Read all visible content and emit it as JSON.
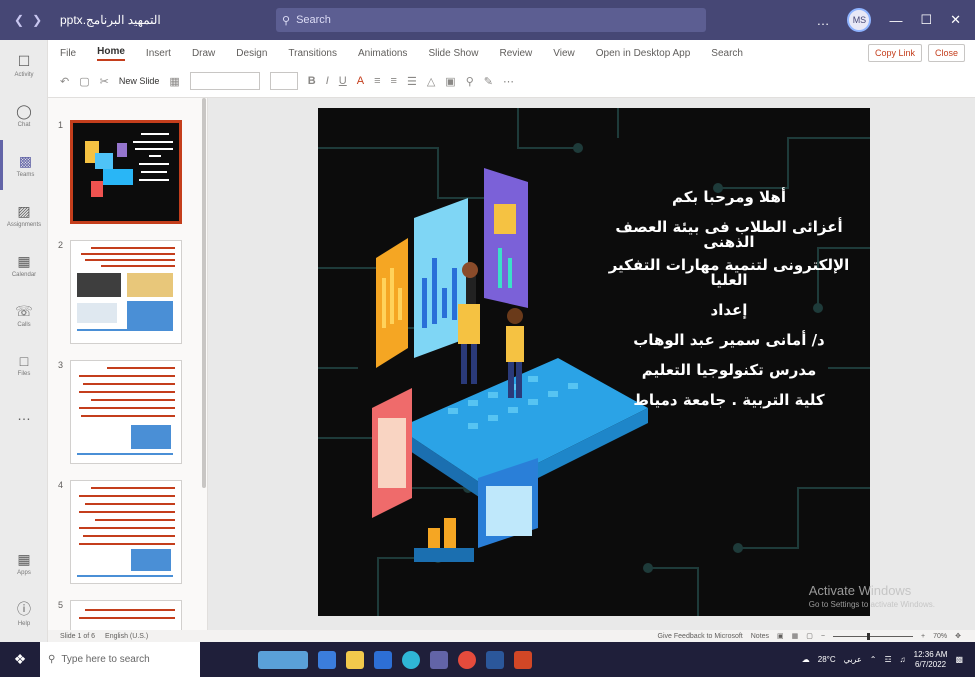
{
  "window": {
    "title": "التمهيد البرنامج.pptx",
    "search_placeholder": "Search",
    "avatar_initials": "MS",
    "controls": [
      "…",
      "—",
      "☐",
      "✕"
    ]
  },
  "rail": {
    "items": [
      {
        "label": "Activity",
        "icon": "bell-icon"
      },
      {
        "label": "Chat",
        "icon": "chat-icon"
      },
      {
        "label": "Teams",
        "icon": "teams-icon"
      },
      {
        "label": "Assignments",
        "icon": "assignments-icon"
      },
      {
        "label": "Calendar",
        "icon": "calendar-icon"
      },
      {
        "label": "Calls",
        "icon": "phone-icon"
      },
      {
        "label": "Files",
        "icon": "file-icon"
      },
      {
        "label": "…",
        "icon": "more-icon"
      }
    ],
    "bottom": [
      {
        "label": "Apps",
        "icon": "apps-icon"
      },
      {
        "label": "Help",
        "icon": "help-icon"
      }
    ]
  },
  "ribbon": {
    "tabs": [
      "File",
      "Home",
      "Insert",
      "Draw",
      "Design",
      "Transitions",
      "Animations",
      "Slide Show",
      "Review",
      "View",
      "Open in Desktop App",
      "Search"
    ],
    "active_tab": "Home",
    "copy_link": "Copy Link",
    "close": "Close",
    "new_slide": "New Slide"
  },
  "thumbnails": [
    {
      "number": "1",
      "selected": true
    },
    {
      "number": "2",
      "selected": false
    },
    {
      "number": "3",
      "selected": false
    },
    {
      "number": "4",
      "selected": false
    },
    {
      "number": "5",
      "selected": false
    }
  ],
  "slide": {
    "lines": [
      "أهلا ومرحبا بكم",
      "أعزائى الطلاب فى بيئة العصف الذهنى",
      "الإلكترونى لتنمية مهارات التفكير العليا",
      "إعداد",
      "د/ أمانى سمير عبد الوهاب",
      "مدرس تكنولوجيا التعليم",
      "كلية التربية . جامعة دمياط"
    ]
  },
  "watermark": {
    "line1": "Activate Windows",
    "line2": "Go to Settings to activate Windows."
  },
  "status": {
    "slide_counter": "Slide 1 of 6",
    "language": "English (U.S.)",
    "feedback": "Give Feedback to Microsoft",
    "notes": "Notes",
    "zoom": "70%"
  },
  "taskbar": {
    "search_placeholder": "Type here to search",
    "weather": "28°C",
    "time": "12:36 AM",
    "date": "6/7/2022",
    "lang": "عربي"
  },
  "colors": {
    "teams_purple": "#464775",
    "ppt_accent": "#c43e1c",
    "slide_bg": "#0c0c0c"
  }
}
